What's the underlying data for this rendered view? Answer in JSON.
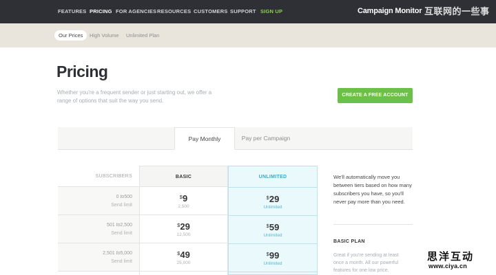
{
  "nav": {
    "items": [
      "FEATURES",
      "PRICING",
      "FOR AGENCIES",
      "RESOURCES",
      "CUSTOMERS",
      "SUPPORT",
      "SIGN UP"
    ],
    "brand": "Campaign Monitor",
    "watermark": "互联网的一些事"
  },
  "subnav": {
    "items": [
      "Our Prices",
      "High Volume",
      "Unlimited Plan"
    ]
  },
  "hero": {
    "title": "Pricing",
    "intro": "Whether you're a frequent sender or just starting out, we offer a range of options that suit the way you send.",
    "cta": "CREATE A FREE ACCOUNT"
  },
  "tabs": {
    "active": "Pay Monthly",
    "inactive": "Pay per Campaign"
  },
  "table": {
    "headers": {
      "subscribers": "SUBSCRIBERS",
      "basic": "BASIC",
      "unlimited": "UNLIMITED"
    },
    "rows": [
      {
        "from": "0",
        "to_word": "to",
        "to": "500",
        "limit_label": "Send limit",
        "basic_currency": "$",
        "basic_price": "9",
        "basic_limit": "2,500",
        "unl_currency": "$",
        "unl_price": "29",
        "unl_label": "Unlimited"
      },
      {
        "from": "501",
        "to_word": "to",
        "to": "2,500",
        "limit_label": "Send limit",
        "basic_currency": "$",
        "basic_price": "29",
        "basic_limit": "12,500",
        "unl_currency": "$",
        "unl_price": "59",
        "unl_label": "Unlimited"
      },
      {
        "from": "2,501",
        "to_word": "to",
        "to": "5,000",
        "limit_label": "Send limit",
        "basic_currency": "$",
        "basic_price": "49",
        "basic_limit": "25,000",
        "unl_currency": "$",
        "unl_price": "99",
        "unl_label": "Unlimited"
      }
    ]
  },
  "info": {
    "text": "We'll automatically move you between tiers based on how many subscribers you have, so you'll never pay more than you need.",
    "plan_title": "BASIC PLAN",
    "plan_text": "Great if you're sending at least once a month. All our powerful features for one low price."
  },
  "watermark2": {
    "cn": "思洋互动",
    "url": "www.ciya.cn"
  }
}
